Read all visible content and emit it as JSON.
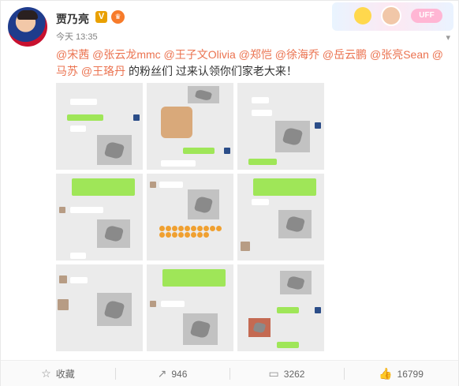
{
  "user": {
    "name": "贾乃亮",
    "verified": "V",
    "vip": "VIP"
  },
  "post": {
    "time": "今天 13:35",
    "mentions": [
      "@宋茜",
      "@张云龙mmc",
      "@王子文Olivia",
      "@郑恺",
      "@徐海乔",
      "@岳云鹏",
      "@张亮Sean",
      "@马苏",
      "@王珞丹"
    ],
    "text_suffix": "的粉丝们  过来认领你们家老大来！"
  },
  "banner": {
    "label": "UFF"
  },
  "expand_icon": "chevron-down-icon",
  "actions": {
    "favorite": {
      "label": "收藏",
      "icon": "star-icon"
    },
    "repost": {
      "count": "946",
      "icon": "repost-icon"
    },
    "comment": {
      "count": "3262",
      "icon": "comment-icon"
    },
    "like": {
      "count": "16799",
      "icon": "thumb-up-icon"
    }
  },
  "colors": {
    "mention": "#eb7350",
    "bubble_green": "#9fe658"
  }
}
